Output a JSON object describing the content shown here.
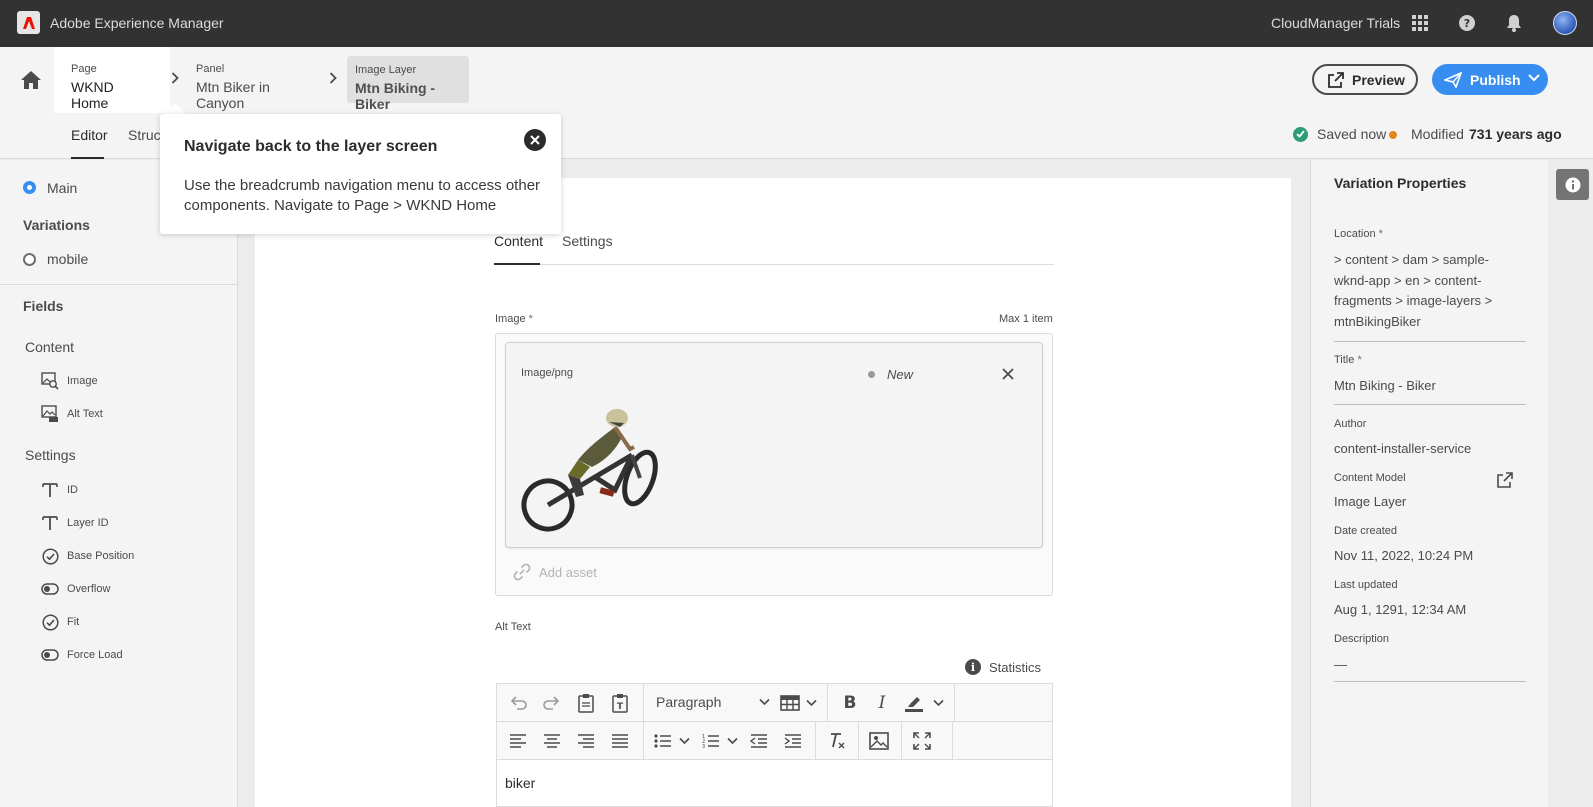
{
  "topbar": {
    "app_title": "Adobe Experience Manager",
    "org": "CloudManager Trials"
  },
  "breadcrumb": [
    {
      "label": "Page",
      "value": "WKND Home"
    },
    {
      "label": "Panel",
      "value": "Mtn Biker in Canyon"
    },
    {
      "label": "Image Layer",
      "value": "Mtn Biking - Biker"
    }
  ],
  "actions": {
    "preview": "Preview",
    "publish": "Publish"
  },
  "tabs": {
    "editor": "Editor",
    "structure": "Struct"
  },
  "status": {
    "saved": "Saved now",
    "modified_label": "Modified",
    "modified_ago": "731 years ago"
  },
  "left_panel": {
    "main": "Main",
    "variations_heading": "Variations",
    "variation": "mobile",
    "fields_heading": "Fields",
    "content_group": "Content",
    "content_fields": [
      "Image",
      "Alt Text"
    ],
    "settings_group": "Settings",
    "settings_fields": [
      "ID",
      "Layer ID",
      "Base Position",
      "Overflow",
      "Fit",
      "Force Load"
    ]
  },
  "editor": {
    "tab_content": "Content",
    "tab_settings": "Settings",
    "image_label": "Image",
    "image_required": "*",
    "max_items": "Max 1 item",
    "asset_type": "Image/png",
    "asset_status": "New",
    "add_asset": "Add asset",
    "alt_text_label": "Alt Text",
    "statistics": "Statistics",
    "paragraph": "Paragraph",
    "rte_value": "biker"
  },
  "right_panel": {
    "title": "Variation Properties",
    "location_label": "Location",
    "location_required": "*",
    "location_value": " > content > dam > sample-wknd-app > en > content-fragments > image-layers > mtnBikingBiker",
    "title_label": "Title",
    "title_required": "*",
    "title_value": "Mtn Biking - Biker",
    "author_label": "Author",
    "author_value": "content-installer-service",
    "model_label": "Content Model",
    "model_value": "Image Layer",
    "created_label": "Date created",
    "created_value": "Nov 11, 2022, 10:24 PM",
    "updated_label": "Last updated",
    "updated_value": "Aug 1, 1291, 12:34 AM",
    "description_label": "Description",
    "description_value": "—"
  },
  "popover": {
    "title": "Navigate back to the layer screen",
    "body": "Use the breadcrumb navigation menu to access other components. Navigate to Page > WKND Home"
  },
  "colors": {
    "accent": "#378ef0",
    "topbar": "#323232",
    "saved": "#2d9d78",
    "modified": "#e68619"
  }
}
